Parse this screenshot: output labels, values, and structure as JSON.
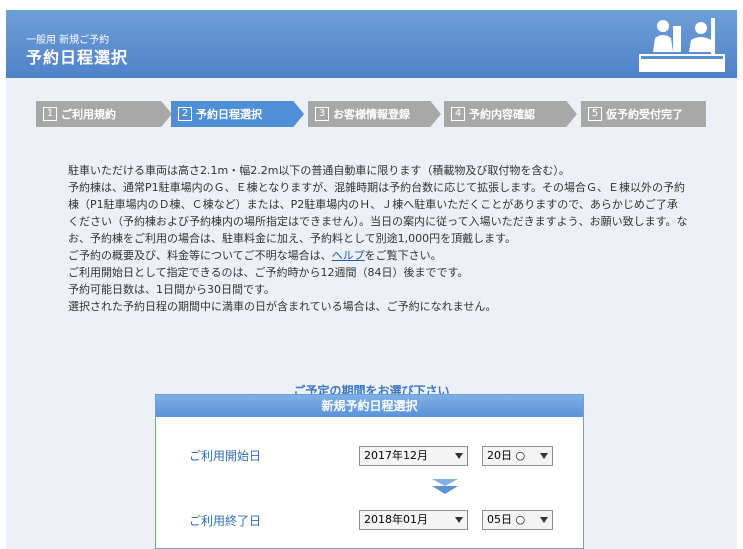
{
  "header": {
    "subtitle": "一般用 新規ご予約",
    "title": "予約日程選択"
  },
  "steps": [
    {
      "num": "1",
      "label": "ご利用規約",
      "state": "inactive"
    },
    {
      "num": "2",
      "label": "予約日程選択",
      "state": "active"
    },
    {
      "num": "3",
      "label": "お客様情報登録",
      "state": "inactive"
    },
    {
      "num": "4",
      "label": "予約内容確認",
      "state": "inactive"
    },
    {
      "num": "5",
      "label": "仮予約受付完了",
      "state": "inactive"
    }
  ],
  "notice": {
    "p1": "駐車いただける車両は高さ2.1m・幅2.2m以下の普通自動車に限ります（積載物及び取付物を含む）。",
    "p2": "予約棟は、通常P1駐車場内のＧ、Ｅ棟となりますが、混雑時期は予約台数に応じて拡張します。その場合Ｇ、Ｅ棟以外の予約棟（P1駐車場内のＤ棟、Ｃ棟など）または、P2駐車場内のＨ、Ｊ棟へ駐車いただくことがありますので、あらかじめご了承ください（予約棟および予約棟内の場所指定はできません）。当日の案内に従って入場いただきますよう、お願い致します。なお、予約棟をご利用の場合は、駐車料金に加え、予約料として別途1,000円を頂戴します。",
    "p3_before": "ご予約の概要及び、料金等についてご不明な場合は、",
    "p3_link": "ヘルプ",
    "p3_after": "をご覧下さい。",
    "p4": "ご利用開始日として指定できるのは、ご予約時から12週間（84日）後までです。",
    "p5": "予約可能日数は、1日間から30日間です。",
    "p6": "選択された予約日程の期間中に満車の日が含まれている場合は、ご予約になれません。"
  },
  "period": {
    "heading": "ご予定の期間をお選び下さい",
    "box_title": "新規予約日程選択",
    "start_label": "ご利用開始日",
    "start_month": "2017年12月",
    "start_day": "20日 ○",
    "end_label": "ご利用終了日",
    "end_month": "2018年01月",
    "end_day": "05日 ○"
  },
  "colors": {
    "header": "#5a8fd0",
    "step_active": "#4f8fd6",
    "step_inactive": "#a8a8a8",
    "accent_text": "#3a78c2"
  },
  "icons": {
    "header": "reception-desk-icon",
    "between_dates": "down-arrow-icon"
  }
}
